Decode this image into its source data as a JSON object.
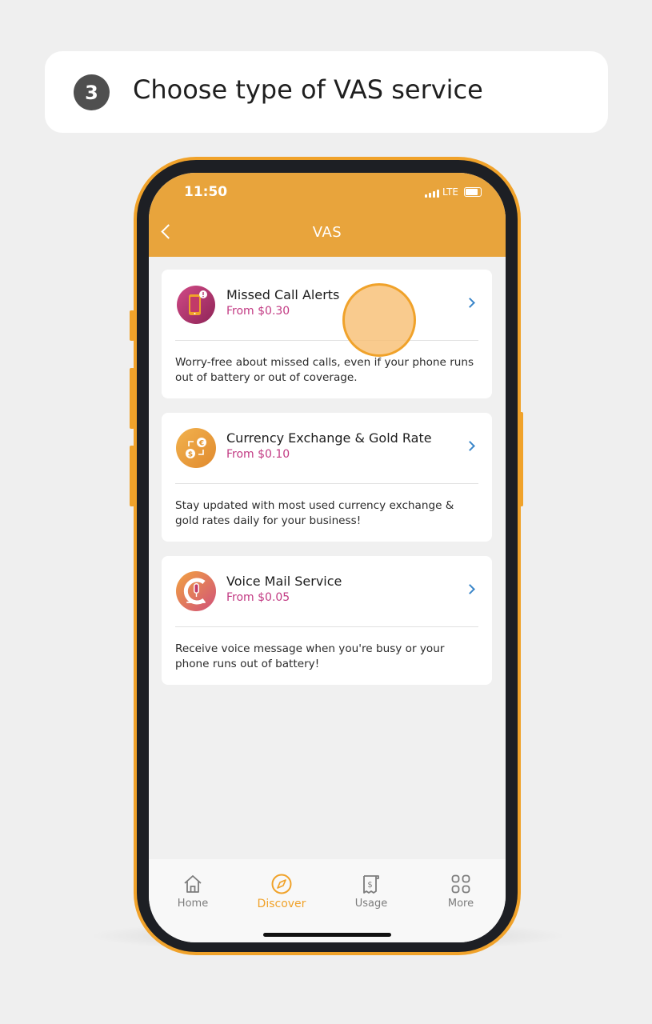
{
  "step": {
    "number": "3",
    "text": "Choose type of VAS service"
  },
  "status_bar": {
    "time": "11:50",
    "network": "LTE"
  },
  "header": {
    "title": "VAS"
  },
  "services": [
    {
      "title": "Missed Call Alerts",
      "price": "From $0.30",
      "description": "Worry-free about missed calls, even if your phone runs out of battery or out of coverage.",
      "icon": "missed-call-phone-icon"
    },
    {
      "title": "Currency Exchange & Gold Rate",
      "price": "From $0.10",
      "description": "Stay updated with most used currency exchange & gold rates daily for your business!",
      "icon": "currency-exchange-icon"
    },
    {
      "title": "Voice Mail Service",
      "price": "From $0.05",
      "description": "Receive voice message when you're busy or your phone runs out of battery!",
      "icon": "voicemail-icon"
    }
  ],
  "bottom_nav": [
    {
      "label": "Home",
      "icon": "home-icon",
      "active": false
    },
    {
      "label": "Discover",
      "icon": "compass-icon",
      "active": true
    },
    {
      "label": "Usage",
      "icon": "receipt-icon",
      "active": false
    },
    {
      "label": "More",
      "icon": "grid-icon",
      "active": false
    }
  ],
  "colors": {
    "accent": "#e8a43c",
    "price": "#c23a83",
    "chevron": "#3a86c9",
    "frame": "#f0a22a"
  }
}
